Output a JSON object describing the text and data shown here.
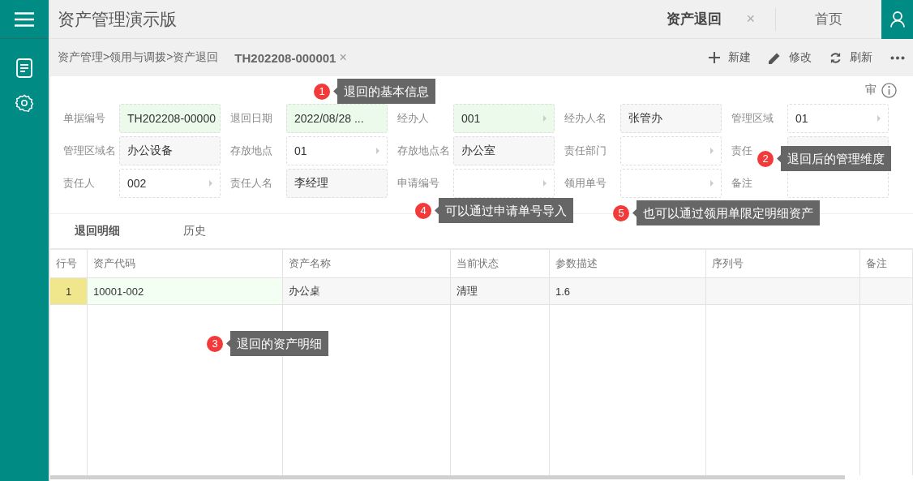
{
  "app": {
    "title": "资产管理演示版"
  },
  "tabs": [
    {
      "label": "资产退回",
      "close": "×",
      "selected": true
    },
    {
      "label": "首页",
      "selected": false
    }
  ],
  "breadcrumb": {
    "path": "资产管理>领用与调拨>资产退回",
    "document": "TH202208-000001",
    "close": "×"
  },
  "toolbar": [
    {
      "kind": "add",
      "label": "新建"
    },
    {
      "kind": "edit",
      "label": "修改"
    },
    {
      "kind": "refresh",
      "label": "刷新"
    },
    {
      "kind": "more"
    }
  ],
  "form": {
    "audit_label": "审",
    "fields": [
      {
        "label": "单据编号",
        "value": "TH202208-00000",
        "kind": "input",
        "required": true
      },
      {
        "label": "退回日期",
        "value": "2022/08/28 ...",
        "kind": "input",
        "required": true
      },
      {
        "label": "经办人",
        "value": "001",
        "kind": "lookup",
        "required": true
      },
      {
        "label": "经办人名",
        "value": "张管办",
        "kind": "readonly",
        "required": false
      },
      {
        "label": "管理区域",
        "value": "01",
        "kind": "lookup",
        "required": false
      },
      {
        "label": "管理区域名",
        "value": "办公设备",
        "kind": "readonly",
        "required": false
      },
      {
        "label": "存放地点",
        "value": "01",
        "kind": "lookup",
        "required": false
      },
      {
        "label": "存放地点名",
        "value": "办公室",
        "kind": "readonly",
        "required": false
      },
      {
        "label": "责任部门",
        "kind": "lookup",
        "required": false
      },
      {
        "label": "责任",
        "kind": "readonly",
        "required": false
      },
      {
        "label": "责任人",
        "value": "002",
        "kind": "lookup",
        "required": false
      },
      {
        "label": "责任人名",
        "value": "李经理",
        "kind": "readonly",
        "required": false
      },
      {
        "label": "申请编号",
        "kind": "lookup",
        "required": false
      },
      {
        "label": "领用单号",
        "kind": "lookup",
        "required": false
      },
      {
        "label": "备注",
        "kind": "input",
        "required": false
      }
    ]
  },
  "section_tabs": [
    {
      "label": "退回明细",
      "selected": true
    },
    {
      "label": "历史",
      "selected": false
    }
  ],
  "table": {
    "columns": [
      "行号",
      "资产代码",
      "资产名称",
      "当前状态",
      "参数描述",
      "序列号",
      "备注"
    ],
    "rows": [
      {
        "selected": true,
        "cells": [
          "1",
          "10001-002",
          "办公桌",
          "清理",
          "1.6",
          "",
          ""
        ]
      }
    ]
  },
  "annotations": [
    {
      "number": "1",
      "text": "退回的基本信息"
    },
    {
      "number": "2",
      "text": "退回后的管理维度"
    },
    {
      "number": "3",
      "text": "退回的资产明细"
    },
    {
      "number": "4",
      "text": "可以通过申请单号导入"
    },
    {
      "number": "5",
      "text": "也可以通过领用单限定明细资产"
    }
  ]
}
